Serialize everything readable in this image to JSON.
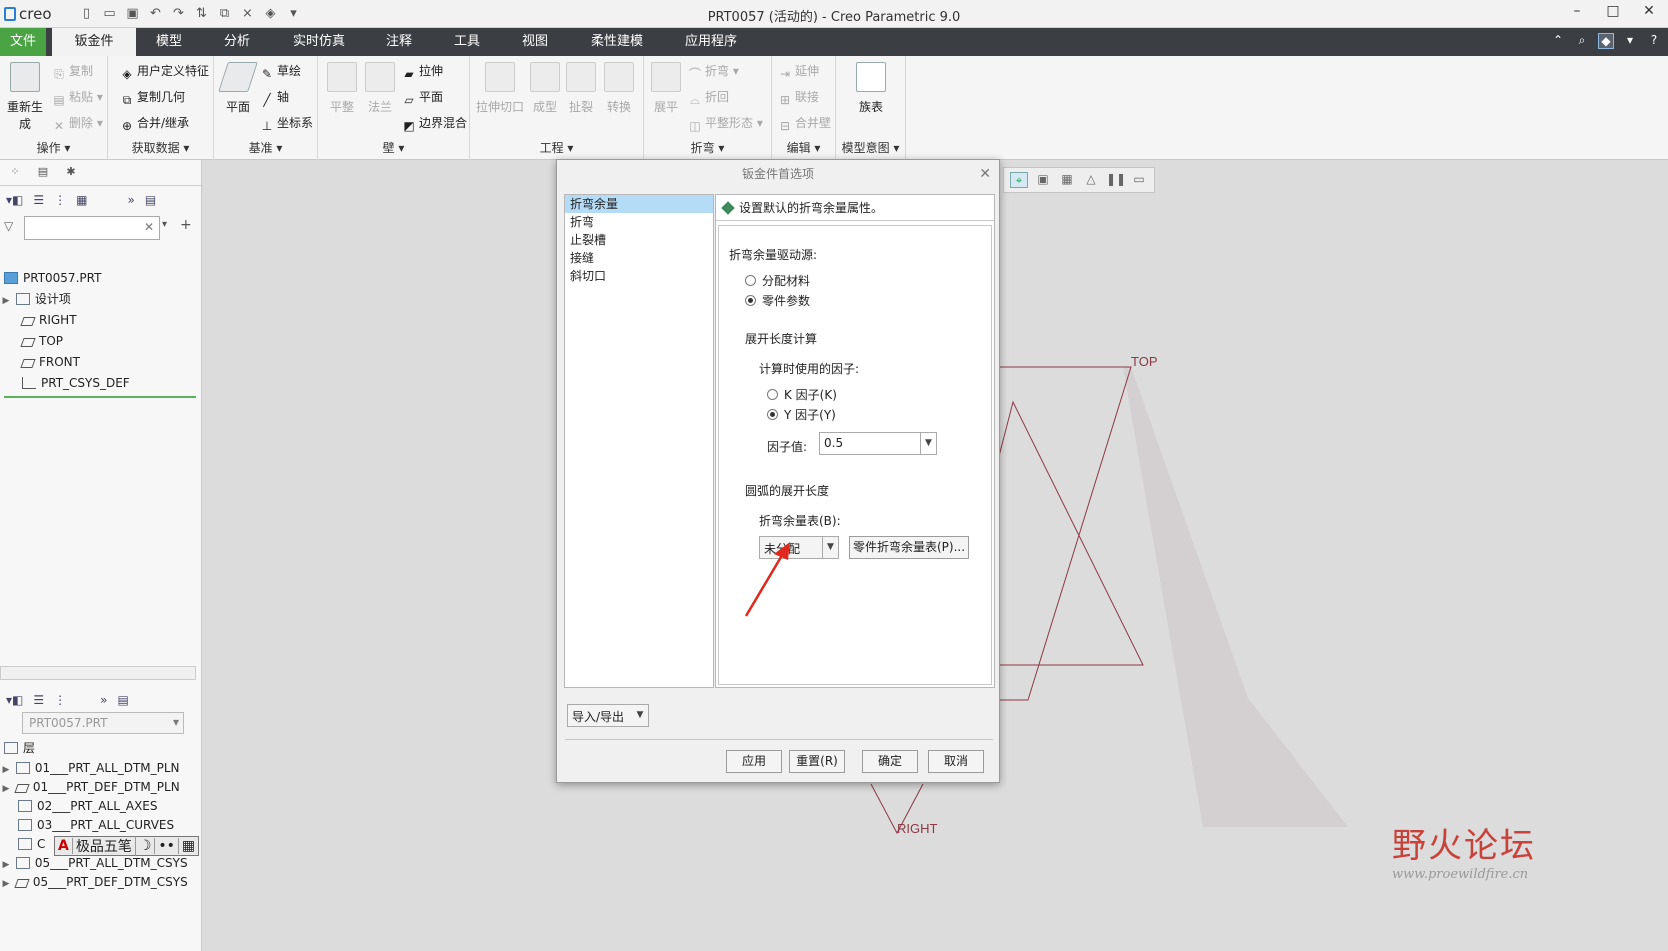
{
  "app": {
    "logo": "creo",
    "window_title": "PRT0057 (活动的) - Creo Parametric 9.0"
  },
  "tabs": [
    "文件",
    "钣金件",
    "模型",
    "分析",
    "实时仿真",
    "注释",
    "工具",
    "视图",
    "柔性建模",
    "应用程序"
  ],
  "ribbon": {
    "ops": {
      "label": "操作",
      "regen": "重新生成",
      "copy": "复制",
      "paste": "粘贴",
      "delete": "删除"
    },
    "getdata": {
      "label": "获取数据",
      "udf": "用户定义特征",
      "copygeom": "复制几何",
      "merge": "合并/继承"
    },
    "datum": {
      "label": "基准",
      "plane": "平面",
      "sketch": "草绘",
      "axis": "轴",
      "csys": "坐标系"
    },
    "wall": {
      "label": "壁",
      "flat": "平整",
      "flange": "法兰",
      "extrude": "拉伸",
      "planar": "平面",
      "blend": "边界混合"
    },
    "eng": {
      "label": "工程",
      "extcut": "拉伸切口",
      "form": "成型",
      "rip": "扯裂",
      "convert": "转换"
    },
    "bend": {
      "label": "折弯",
      "unbend": "展平",
      "bend": "折弯",
      "bendback": "折回",
      "flatform": "平整形态"
    },
    "edit": {
      "label": "编辑",
      "extend": "延伸",
      "join": "联接",
      "mergewall": "合并壁"
    },
    "intent": {
      "label": "模型意图",
      "family": "族表"
    }
  },
  "tree": {
    "root": "PRT0057.PRT",
    "items": [
      "设计项",
      "RIGHT",
      "TOP",
      "FRONT",
      "PRT_CSYS_DEF"
    ]
  },
  "layers": {
    "model": "PRT0057.PRT",
    "header": "层",
    "items": [
      "01___PRT_ALL_DTM_PLN",
      "01___PRT_DEF_DTM_PLN",
      "02___PRT_ALL_AXES",
      "03___PRT_ALL_CURVES",
      "C",
      "05___PRT_ALL_DTM_CSYS",
      "05___PRT_DEF_DTM_CSYS"
    ]
  },
  "ime": {
    "a": "A",
    "name": "极品五笔",
    "moon": "☽",
    "dots": "••",
    "kbd": "▦"
  },
  "datum_labels": {
    "top": "TOP",
    "right": "RIGHT"
  },
  "dialog": {
    "title": "钣金件首选项",
    "nav": [
      "折弯余量",
      "折弯",
      "止裂槽",
      "接缝",
      "斜切口"
    ],
    "header": "设置默认的折弯余量属性。",
    "source_label": "折弯余量驱动源:",
    "source_opts": [
      "分配材料",
      "零件参数"
    ],
    "dev_label": "展开长度计算",
    "factor_label": "计算时使用的因子:",
    "factor_opts": [
      "K 因子(K)",
      "Y 因子(Y)"
    ],
    "value_label": "因子值:",
    "value": "0.5",
    "arc_label": "圆弧的展开长度",
    "table_label": "折弯余量表(B):",
    "table_value": "未分配",
    "part_table_btn": "零件折弯余量表(P)...",
    "import_export": "导入/导出",
    "apply": "应用",
    "reset": "重置(R)",
    "ok": "确定",
    "cancel": "取消"
  },
  "watermark": {
    "cn": "野火论坛",
    "url": "www.proewildfire.cn"
  },
  "colors": {
    "accent_file": "#4aa444",
    "tabbar": "#3b3f44",
    "nav_selected": "#b5dcf7",
    "datum": "#8a3a45",
    "arrow": "#e0281e"
  }
}
